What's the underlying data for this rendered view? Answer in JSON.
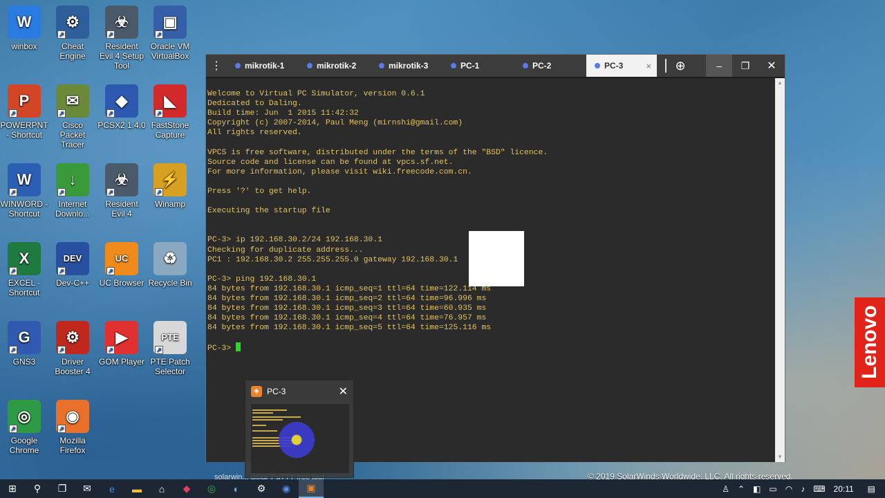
{
  "desktop": {
    "icons": [
      {
        "label": "winbox",
        "glyph": "W",
        "color": "#2a7be0"
      },
      {
        "label": "Cheat Engine",
        "glyph": "⚙",
        "color": "#2f5f9a"
      },
      {
        "label": "Resident Evil 4 Setup Tool",
        "glyph": "☣",
        "color": "#4a5a6a"
      },
      {
        "label": "Oracle VM VirtualBox",
        "glyph": "▣",
        "color": "#3560a8"
      },
      {
        "label": "POWERPNT - Shortcut",
        "glyph": "P",
        "color": "#d24625"
      },
      {
        "label": "Cisco Packet Tracer",
        "glyph": "✉",
        "color": "#6a8a3a"
      },
      {
        "label": "PCSX2 1.4.0",
        "glyph": "◆",
        "color": "#2c58b0"
      },
      {
        "label": "FastStone Capture",
        "glyph": "◣",
        "color": "#d22a2a"
      },
      {
        "label": "WINWORD - Shortcut",
        "glyph": "W",
        "color": "#2b5fb3"
      },
      {
        "label": "Internet Downlo...",
        "glyph": "↓",
        "color": "#3a9a3a"
      },
      {
        "label": "Resident Evil 4",
        "glyph": "☣",
        "color": "#4a5a6a"
      },
      {
        "label": "Winamp",
        "glyph": "⚡",
        "color": "#d8a020"
      },
      {
        "label": "EXCEL - Shortcut",
        "glyph": "X",
        "color": "#1f7a40"
      },
      {
        "label": "Dev-C++",
        "glyph": "DEV",
        "color": "#2950a0"
      },
      {
        "label": "UC Browser",
        "glyph": "UC",
        "color": "#f08a1a"
      },
      {
        "label": "Recycle Bin",
        "glyph": "♻",
        "color": "#8aa8c0"
      },
      {
        "label": "GNS3",
        "glyph": "G",
        "color": "#2f5ab0"
      },
      {
        "label": "Driver Booster 4",
        "glyph": "⚙",
        "color": "#c0281e"
      },
      {
        "label": "GOM Player",
        "glyph": "▶",
        "color": "#e03030"
      },
      {
        "label": "PTE Patch Selector",
        "glyph": "PTE",
        "color": "#d8d8d8"
      },
      {
        "label": "Google Chrome",
        "glyph": "◎",
        "color": "#2f9a45"
      },
      {
        "label": "Mozilla Firefox",
        "glyph": "◉",
        "color": "#e8702a"
      }
    ]
  },
  "window": {
    "tabs": [
      "mikrotik-1",
      "mikrotik-2",
      "mikrotik-3",
      "PC-1",
      "PC-2",
      "PC-3"
    ],
    "active_tab": "PC-3",
    "tab_close": "×",
    "add_label": "⊕",
    "min_label": "–",
    "max_label": "❐",
    "close_label": "✕"
  },
  "terminal": {
    "lines": [
      "Welcome to Virtual PC Simulator, version 0.6.1",
      "Dedicated to Daling.",
      "Build time: Jun  1 2015 11:42:32",
      "Copyright (c) 2007-2014, Paul Meng (mirnshi@gmail.com)",
      "All rights reserved.",
      "",
      "VPCS is free software, distributed under the terms of the \"BSD\" licence.",
      "Source code and license can be found at vpcs.sf.net.",
      "For more information, please visit wiki.freecode.com.cn.",
      "",
      "Press '?' to get help.",
      "",
      "Executing the startup file",
      "",
      "",
      "PC-3> ip 192.168.30.2/24 192.168.30.1",
      "Checking for duplicate address...",
      "PC1 : 192.168.30.2 255.255.255.0 gateway 192.168.30.1",
      "",
      "PC-3> ping 192.168.30.1",
      "84 bytes from 192.168.30.1 icmp_seq=1 ttl=64 time=122.114 ms",
      "84 bytes from 192.168.30.1 icmp_seq=2 ttl=64 time=96.996 ms",
      "84 bytes from 192.168.30.1 icmp_seq=3 ttl=64 time=60.935 ms",
      "84 bytes from 192.168.30.1 icmp_seq=4 ttl=64 time=76.957 ms",
      "84 bytes from 192.168.30.1 icmp_seq=5 ttl=64 time=125.116 ms",
      ""
    ],
    "prompt": "PC-3> "
  },
  "preview": {
    "title": "PC-3",
    "close_label": "✕"
  },
  "under_text": "solarwin...   Solar-PuTTY free tool",
  "copyright": "© 2019 SolarWinds Worldwide, LLC. All rights reserved.",
  "lenovo": "Lenovo",
  "taskbar": {
    "clock": "20:11"
  }
}
